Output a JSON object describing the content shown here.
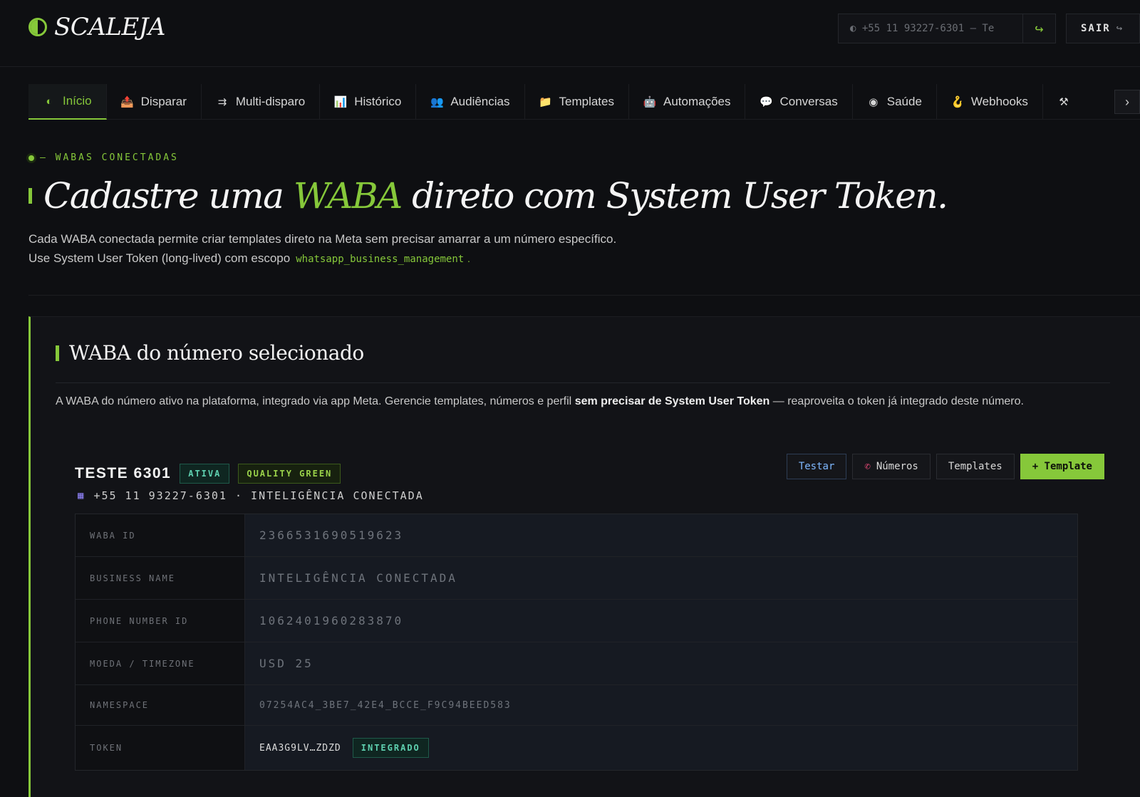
{
  "header": {
    "brand": "SCALEJA",
    "phone_selector": "◐ +55 11 93227-6301 — Te",
    "phone_go_icon": "arrow-right-hook-icon",
    "logout_label": "SAIR",
    "logout_icon": "↪"
  },
  "tabs": [
    {
      "label": "Início",
      "icon": "◐",
      "active": true
    },
    {
      "label": "Disparar",
      "icon": "📤"
    },
    {
      "label": "Multi-disparo",
      "icon": "⇉"
    },
    {
      "label": "Histórico",
      "icon": "📊"
    },
    {
      "label": "Audiências",
      "icon": "👥"
    },
    {
      "label": "Templates",
      "icon": "📁"
    },
    {
      "label": "Automações",
      "icon": "🤖"
    },
    {
      "label": "Conversas",
      "icon": "💬"
    },
    {
      "label": "Saúde",
      "icon": "◉"
    },
    {
      "label": "Webhooks",
      "icon": "🪝"
    },
    {
      "label": "",
      "icon": "⚒"
    }
  ],
  "hero": {
    "eyebrow": "— WABAS CONECTADAS",
    "title_before": "Cadastre uma ",
    "title_accent": "WABA",
    "title_after": " direto com System User Token.",
    "desc_line1": "Cada WABA conectada permite criar templates direto na Meta sem precisar amarrar a um número específico.",
    "desc_line2": "Use System User Token (long-lived) com escopo",
    "desc_code": "whatsapp_business_management",
    "desc_end": "."
  },
  "section": {
    "title": "WABA do número selecionado",
    "desc_before": "A WABA do número ativo na plataforma, integrado via app Meta. Gerencie templates, números e perfil ",
    "desc_bold": "sem precisar de System User Token",
    "desc_after": " — reaproveita o token já integrado deste número."
  },
  "waba": {
    "name": "TESTE 6301",
    "badge_status": "ATIVA",
    "badge_quality": "QUALITY GREEN",
    "subtitle": "+55 11 93227-6301 · INTELIGÊNCIA CONECTADA",
    "actions": {
      "testar": "Testar",
      "numeros": "Números",
      "templates": "Templates",
      "new_template": "+ Template"
    },
    "fields": {
      "waba_id_label": "WABA ID",
      "waba_id": "2366531690519623",
      "business_name_label": "BUSINESS NAME",
      "business_name": "INTELIGÊNCIA CONECTADA",
      "phone_number_id_label": "PHONE NUMBER ID",
      "phone_number_id": "1062401960283870",
      "currency_tz_label": "MOEDA / TIMEZONE",
      "currency_tz": "USD 25",
      "namespace_label": "NAMESPACE",
      "namespace": "07254AC4_3BE7_42E4_BCCE_F9C94BEED583",
      "token_label": "TOKEN",
      "token": "EAA3G9LV…ZDZD",
      "token_badge": "INTEGRADO"
    }
  },
  "colors": {
    "accent": "#86c83a",
    "background": "#0e0f12",
    "teal": "#5fd1b0"
  }
}
